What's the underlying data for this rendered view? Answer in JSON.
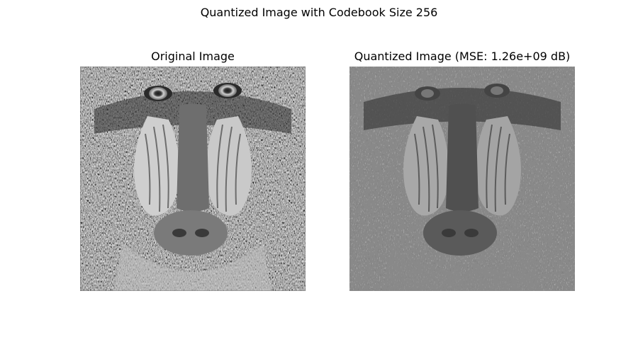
{
  "figure": {
    "suptitle": "Quantized Image with Codebook Size 256"
  },
  "panels": [
    {
      "title": "Original Image",
      "image": "baboon-face-grayscale"
    },
    {
      "title": "Quantized Image (MSE: 1.26e+09 dB)",
      "image": "baboon-face-quantized-grayscale"
    }
  ]
}
